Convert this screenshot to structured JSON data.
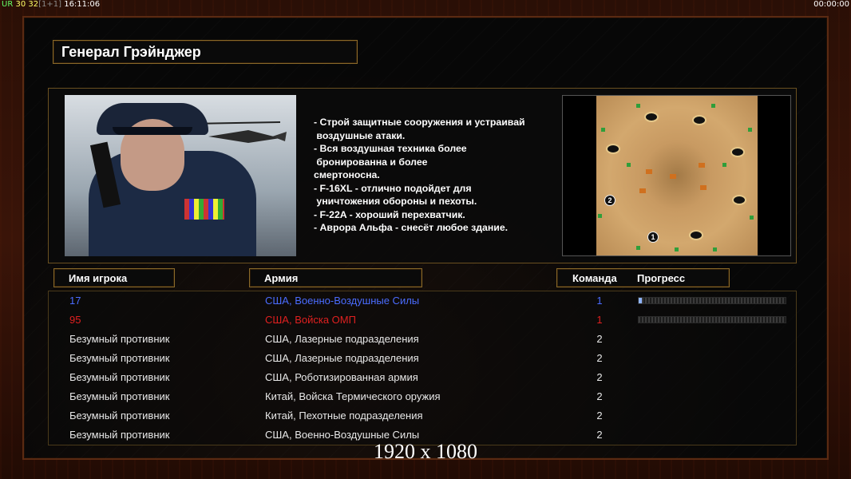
{
  "hud": {
    "ur_label": "UR",
    "fps": "30 32",
    "net": "[1+1]",
    "clock": "16:11:06",
    "timer": "00:00:00"
  },
  "general": {
    "title": "Генерал Грэйнджер",
    "bullets": [
      "- Строй защитные сооружения и устраивай",
      " воздушные атаки.",
      "- Вся воздушная техника более",
      " бронированна и более",
      "смертоносна.",
      "- F-16XL - отлично подойдет для",
      " уничтожения обороны и пехоты.",
      "- F-22A - хороший перехватчик.",
      "- Аврора Альфа - снесёт любое здание."
    ]
  },
  "minimap": {
    "spawn_labels": [
      "2",
      "1"
    ]
  },
  "columns": {
    "name": "Имя игрока",
    "army": "Армия",
    "team": "Команда",
    "progress": "Прогресс"
  },
  "players": [
    {
      "name": "17",
      "army": "США, Военно-Воздушные Силы",
      "team": "1",
      "color": "#4a6cff",
      "progress": 0.02,
      "show_progress": true
    },
    {
      "name": "95",
      "army": "США, Войска ОМП",
      "team": "1",
      "color": "#e02020",
      "progress": 0.0,
      "show_progress": true
    },
    {
      "name": "Безумный противник",
      "army": "США, Лазерные подразделения",
      "team": "2",
      "color": "#e8e8e8",
      "show_progress": false
    },
    {
      "name": "Безумный противник",
      "army": "США, Лазерные подразделения",
      "team": "2",
      "color": "#e8e8e8",
      "show_progress": false
    },
    {
      "name": "Безумный противник",
      "army": "США, Роботизированная армия",
      "team": "2",
      "color": "#e8e8e8",
      "show_progress": false
    },
    {
      "name": "Безумный противник",
      "army": "Китай, Войска Термического оружия",
      "team": "2",
      "color": "#e8e8e8",
      "show_progress": false
    },
    {
      "name": "Безумный противник",
      "army": "Китай, Пехотные подразделения",
      "team": "2",
      "color": "#e8e8e8",
      "show_progress": false
    },
    {
      "name": "Безумный противник",
      "army": "США, Военно-Воздушные Силы",
      "team": "2",
      "color": "#e8e8e8",
      "show_progress": false
    }
  ],
  "resolution": "1920 x 1080"
}
